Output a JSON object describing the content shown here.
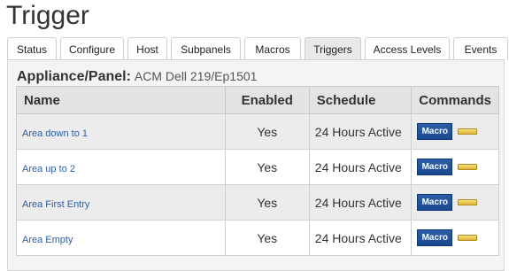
{
  "page": {
    "title": "Trigger"
  },
  "tabs": [
    {
      "label": "Status",
      "active": false
    },
    {
      "label": "Configure",
      "active": false
    },
    {
      "label": "Host",
      "active": false
    },
    {
      "label": "Subpanels",
      "active": false
    },
    {
      "label": "Macros",
      "active": false
    },
    {
      "label": "Triggers",
      "active": true
    },
    {
      "label": "Access Levels",
      "active": false
    },
    {
      "label": "Events",
      "active": false
    }
  ],
  "panel": {
    "label": "Appliance/Panel:",
    "value": "ACM Dell 219/Ep1501"
  },
  "table": {
    "columns": {
      "name": "Name",
      "enabled": "Enabled",
      "schedule": "Schedule",
      "commands": "Commands"
    },
    "rows": [
      {
        "name": "Area down to 1",
        "enabled": "Yes",
        "schedule": "24 Hours Active",
        "macro": "Macro"
      },
      {
        "name": "Area up to 2",
        "enabled": "Yes",
        "schedule": "24 Hours Active",
        "macro": "Macro"
      },
      {
        "name": "Area First Entry",
        "enabled": "Yes",
        "schedule": "24 Hours Active",
        "macro": "Macro"
      },
      {
        "name": "Area Empty",
        "enabled": "Yes",
        "schedule": "24 Hours Active",
        "macro": "Macro"
      }
    ]
  },
  "colors": {
    "link": "#2a5fa3",
    "macro_button": "#174a92",
    "pill_icon": "#e8c94f",
    "active_tab": "#e9e9e9"
  },
  "icons": {
    "command_secondary": "yellow-pill-icon"
  }
}
